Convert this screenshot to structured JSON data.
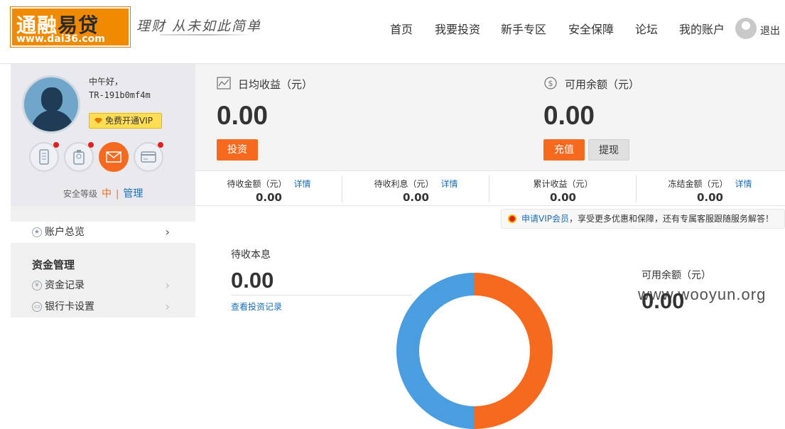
{
  "brand": {
    "logo_cn_a": "通融",
    "logo_cn_b": "易贷",
    "logo_en": "www.dai36.com",
    "slogan": "理财 从未如此简单"
  },
  "nav": {
    "items": [
      "首页",
      "我要投资",
      "新手专区",
      "安全保障",
      "论坛",
      "我的账户"
    ],
    "logout": "退出"
  },
  "user": {
    "greeting": "中午好，",
    "username": "TR-191b0mf4m",
    "vip_button": "免费开通VIP",
    "security_label": "安全等级",
    "security_level": "中",
    "security_sep": "|",
    "manage": "管理"
  },
  "sidebar": {
    "overview": "账户总览",
    "section": "资金管理",
    "items": [
      "资金记录",
      "银行卡设置"
    ]
  },
  "summary": {
    "daily_income_title": "日均收益（元）",
    "daily_income_value": "0.00",
    "invest_button": "投资",
    "balance_title": "可用余额（元）",
    "balance_value": "0.00",
    "recharge_button": "充值",
    "withdraw_button": "提现"
  },
  "stats": [
    {
      "label": "待收金额（元）",
      "link": "详情",
      "value": "0.00"
    },
    {
      "label": "待收利息（元）",
      "link": "详情",
      "value": "0.00"
    },
    {
      "label": "累计收益（元）",
      "link": "",
      "value": "0.00"
    },
    {
      "label": "冻结金额（元）",
      "link": "详情",
      "value": "0.00"
    }
  ],
  "vip_bar": {
    "link": "申请VIP会员",
    "text": "，享受更多优惠和保障，还有专属客服跟随服务解答！"
  },
  "principal": {
    "title": "待收本息",
    "value": "0.00",
    "link": "查看投资记录"
  },
  "available": {
    "title": "可用余额（元）",
    "value": "0.00"
  },
  "watermark": "www.wooyun.org",
  "colors": {
    "accent": "#f66a1f",
    "link": "#1a6fb5",
    "donut_blue": "#4a9ee0"
  }
}
